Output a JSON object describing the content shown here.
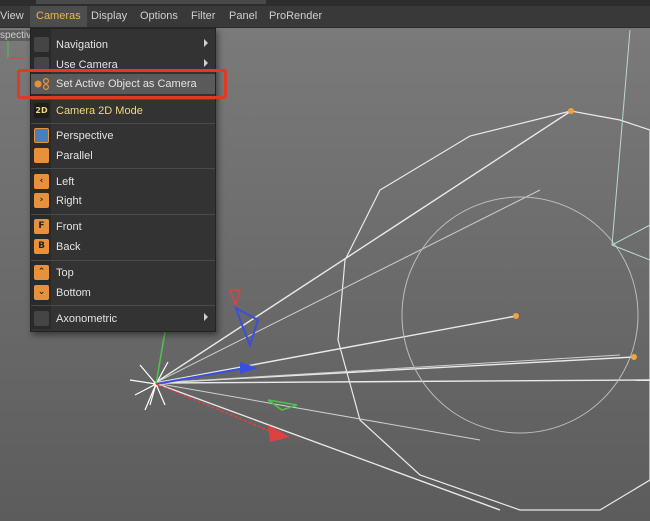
{
  "menubar": {
    "items": [
      "View",
      "Cameras",
      "Display",
      "Options",
      "Filter",
      "Panel",
      "ProRender"
    ],
    "active": "Cameras"
  },
  "viewport": {
    "label": "spective"
  },
  "cameras_menu": {
    "items": [
      {
        "label": "Navigation",
        "icon": "blank",
        "submenu": true
      },
      {
        "label": "Use Camera",
        "icon": "blank",
        "submenu": true
      },
      {
        "label": "Set Active Object as Camera",
        "icon": "set-camera-icon",
        "highlighted": true
      },
      {
        "label": "Camera 2D Mode",
        "icon": "camera-2d-icon"
      },
      {
        "label": "Perspective",
        "icon": "perspective-icon"
      },
      {
        "label": "Parallel",
        "icon": "parallel-icon"
      },
      {
        "label": "Left",
        "icon": "left-arrow-icon"
      },
      {
        "label": "Right",
        "icon": "right-arrow-icon"
      },
      {
        "label": "Front",
        "icon": "front-F-icon"
      },
      {
        "label": "Back",
        "icon": "back-B-icon"
      },
      {
        "label": "Top",
        "icon": "top-arrow-icon"
      },
      {
        "label": "Bottom",
        "icon": "bottom-arrow-icon"
      },
      {
        "label": "Axonometric",
        "icon": "blank",
        "submenu": true
      }
    ]
  },
  "icon_glyphs": {
    "camera2d": "2D",
    "left": "‹",
    "right": "›",
    "front": "F",
    "back": "B",
    "top": "⌃",
    "bottom": "⌄"
  },
  "colors": {
    "menubar_active": "#e8b84a",
    "highlight_box": "#e03a24",
    "icon_orange": "#e8913d",
    "vertex_orange": "#f2a33a"
  }
}
